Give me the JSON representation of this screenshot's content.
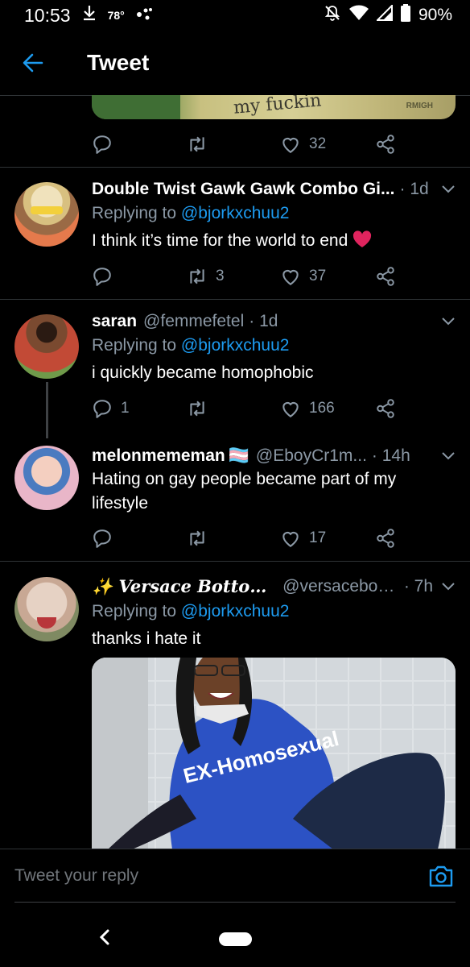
{
  "status_bar": {
    "time": "10:53",
    "temperature": "78°",
    "battery": "90%"
  },
  "header": {
    "title": "Tweet"
  },
  "meme_snippet": {
    "text": "my fuckin",
    "small_text": "RMIGH"
  },
  "tweets": [
    {
      "like_count": "32"
    },
    {
      "name": "Double Twist Gawk Gawk Combo Gi...",
      "time": "· 1d",
      "replying_prefix": "Replying to ",
      "replying_to": "@bjorkxchuu2",
      "text": "I think it’s time for the world to end",
      "retweet_count": "3",
      "like_count": "37"
    },
    {
      "name": "saran",
      "handle": "@femmefetel",
      "time": "· 1d",
      "replying_prefix": "Replying to ",
      "replying_to": "@bjorkxchuu2",
      "text": "i quickly became homophobic",
      "reply_count": "1",
      "like_count": "166"
    },
    {
      "name": "melonmememan",
      "name_emoji": "🏳️‍⚧",
      "handle": "@EboyCr1m...",
      "time": "· 14h",
      "text": "Hating on gay people became part of my lifestyle",
      "like_count": "17"
    },
    {
      "name": "✨ Versace Bottom ✨",
      "handle": "@versacebotto...",
      "time": "· 7h",
      "replying_prefix": "Replying to ",
      "replying_to": "@bjorkxchuu2",
      "text": "thanks i hate it",
      "photo_shirt_text": "EX-Homosexual"
    }
  ],
  "compose": {
    "placeholder": "Tweet your reply"
  },
  "colors": {
    "accent": "#1d9bf0",
    "heart": "#e0245e",
    "muted": "#8b98a5"
  }
}
